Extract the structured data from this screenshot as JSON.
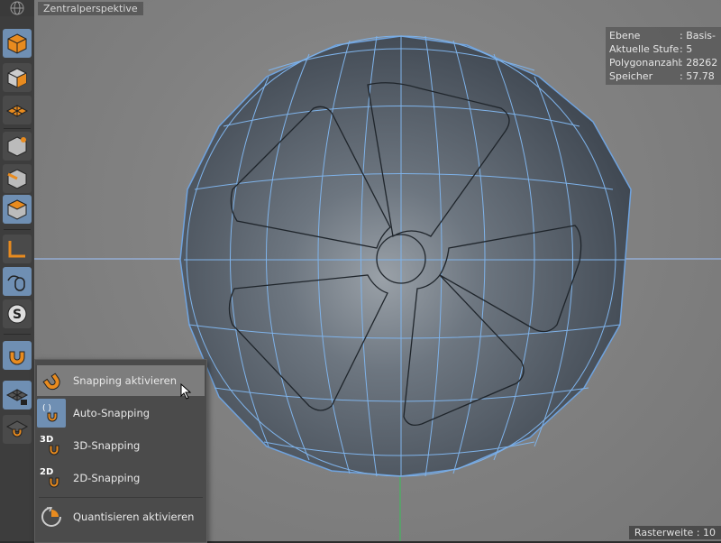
{
  "viewport": {
    "title": "Zentralperspektive"
  },
  "info": {
    "rows": [
      {
        "key": "Ebene",
        "value": ": Basis-"
      },
      {
        "key": "Aktuelle Stufe",
        "value": ": 5"
      },
      {
        "key": "Polygonanzahl",
        "value": ": 28262"
      },
      {
        "key": "Speicher",
        "value": ": 57.78"
      }
    ]
  },
  "status": {
    "raster": "Rasterweite : 10"
  },
  "snap_menu": {
    "items": [
      {
        "label": "Snapping aktivieren",
        "badge": ""
      },
      {
        "label": "Auto-Snapping",
        "badge": ""
      },
      {
        "label": "3D-Snapping",
        "badge": "3D"
      },
      {
        "label": "2D-Snapping",
        "badge": "2D"
      },
      {
        "label": "Quantisieren aktivieren",
        "badge": ""
      }
    ]
  },
  "colors": {
    "accent": "#e88b1f",
    "active": "#6f8fb3",
    "wire": "#7fb3ea"
  }
}
